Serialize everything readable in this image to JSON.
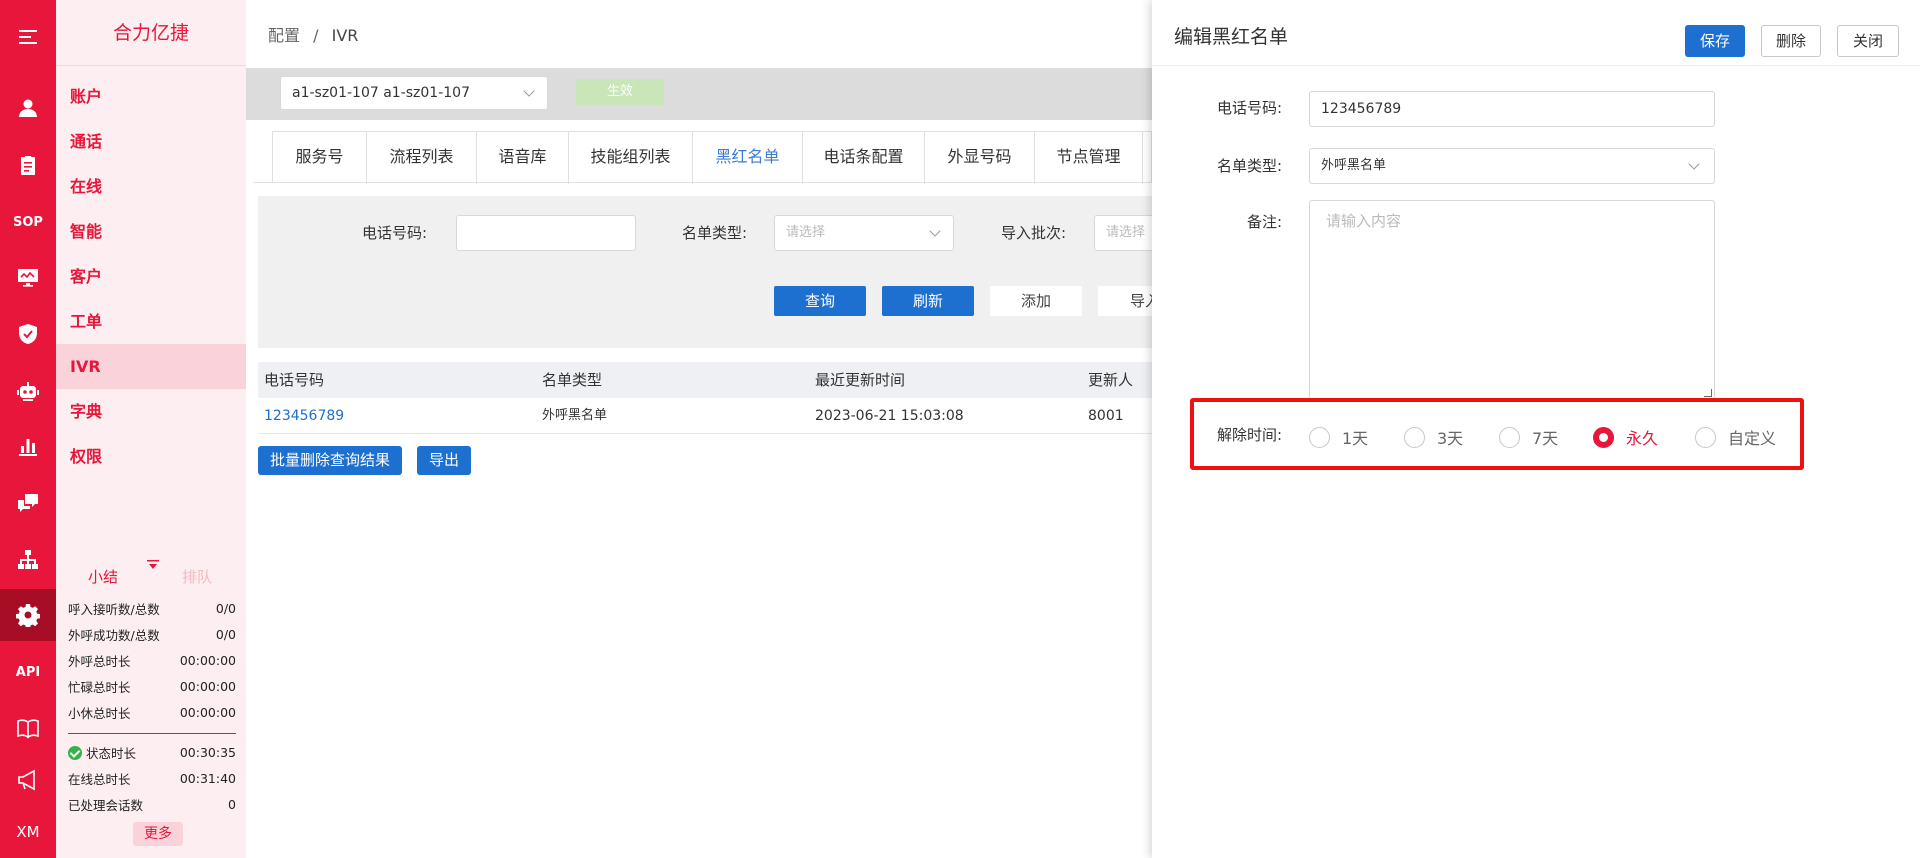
{
  "rail": {
    "sop": "SOP",
    "api": "API",
    "xm": "XM"
  },
  "brand": "合力亿捷",
  "menu": [
    "账户",
    "通话",
    "在线",
    "智能",
    "客户",
    "工单",
    "IVR",
    "字典",
    "权限"
  ],
  "stats": {
    "tab_summary": "小结",
    "tab_queue": "排队",
    "rows": [
      {
        "label": "呼入接听数/总数",
        "value": "0/0"
      },
      {
        "label": "外呼成功数/总数",
        "value": "0/0"
      },
      {
        "label": "外呼总时长",
        "value": "00:00:00"
      },
      {
        "label": "忙碌总时长",
        "value": "00:00:00"
      },
      {
        "label": "小休总时长",
        "value": "00:00:00"
      }
    ],
    "rows2": [
      {
        "label": "状态时长",
        "value": "00:30:35"
      },
      {
        "label": "在线总时长",
        "value": "00:31:40"
      },
      {
        "label": "已处理会话数",
        "value": "0"
      }
    ],
    "more": "更多"
  },
  "breadcrumb": {
    "parent": "配置",
    "sep": "/",
    "current": "IVR"
  },
  "toolbar": {
    "selected": "a1-sz01-107 a1-sz01-107",
    "effect": "生效"
  },
  "tabs": [
    "服务号",
    "流程列表",
    "语音库",
    "技能组列表",
    "黑红名单",
    "电话条配置",
    "外显号码",
    "节点管理"
  ],
  "query": {
    "phone_label": "电话号码:",
    "type_label": "名单类型:",
    "type_placeholder": "请选择",
    "batch_label": "导入批次:",
    "batch_placeholder": "请选择",
    "btn_query": "查询",
    "btn_refresh": "刷新",
    "btn_add": "添加",
    "btn_import": "导入"
  },
  "table": {
    "headers": [
      "电话号码",
      "名单类型",
      "最近更新时间",
      "更新人"
    ],
    "rows": [
      {
        "phone": "123456789",
        "type": "外呼黑名单",
        "updated": "2023-06-21 15:03:08",
        "user": "8001"
      }
    ]
  },
  "bottom": {
    "batch_delete": "批量删除查询结果",
    "export": "导出"
  },
  "drawer": {
    "title": "编辑黑红名单",
    "save": "保存",
    "delete": "删除",
    "close": "关闭",
    "phone_label": "电话号码:",
    "phone_value": "123456789",
    "type_label": "名单类型:",
    "type_value": "外呼黑名单",
    "remark_label": "备注:",
    "remark_placeholder": "请输入内容",
    "release_label": "解除时间:",
    "release_options": [
      "1天",
      "3天",
      "7天",
      "永久",
      "自定义"
    ],
    "release_selected": "永久"
  },
  "colors": {
    "brand_red": "#e8163a",
    "primary_blue": "#1d6fd0",
    "highlight": "#ee1111"
  }
}
